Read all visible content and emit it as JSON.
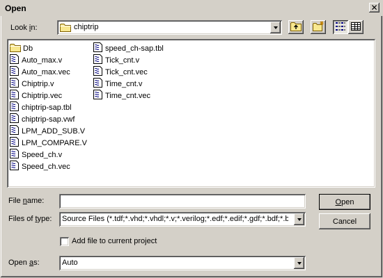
{
  "window": {
    "title": "Open"
  },
  "look_in": {
    "label_pre": "Look ",
    "label_ul": "i",
    "label_post": "n:",
    "value": "chiptrip",
    "value_icon": "folder-icon"
  },
  "toolbar": {
    "up_folder_icon": "up-folder-icon",
    "new_folder_icon": "new-folder-icon",
    "list_view_icon": "list-view-icon",
    "details_view_icon": "details-view-icon"
  },
  "files": {
    "column1": [
      {
        "name": "Db",
        "icon": "folder-icon"
      },
      {
        "name": "Auto_max.v",
        "icon": "document-icon"
      },
      {
        "name": "Auto_max.vec",
        "icon": "document-icon"
      },
      {
        "name": "Chiptrip.v",
        "icon": "document-icon"
      },
      {
        "name": "Chiptrip.vec",
        "icon": "document-icon"
      },
      {
        "name": "chiptrip-sap.tbl",
        "icon": "document-icon"
      },
      {
        "name": "chiptrip-sap.vwf",
        "icon": "document-icon"
      },
      {
        "name": "LPM_ADD_SUB.V",
        "icon": "document-icon"
      },
      {
        "name": "LPM_COMPARE.V",
        "icon": "document-icon"
      },
      {
        "name": "Speed_ch.v",
        "icon": "document-icon"
      },
      {
        "name": "Speed_ch.vec",
        "icon": "document-icon"
      }
    ],
    "column2": [
      {
        "name": "speed_ch-sap.tbl",
        "icon": "document-icon"
      },
      {
        "name": "Tick_cnt.v",
        "icon": "document-icon"
      },
      {
        "name": "Tick_cnt.vec",
        "icon": "document-icon"
      },
      {
        "name": "Time_cnt.v",
        "icon": "document-icon"
      },
      {
        "name": "Time_cnt.vec",
        "icon": "document-icon"
      }
    ]
  },
  "file_name": {
    "label_pre": "File ",
    "label_ul": "n",
    "label_post": "ame:",
    "value": ""
  },
  "file_type": {
    "label_pre": "Files of ",
    "label_ul": "t",
    "label_post": "ype:",
    "value": "Source Files (*.tdf;*.vhd;*.vhdl;*.v;*.verilog;*.edf;*.edif;*.gdf;*.bdf;*.bsf;*"
  },
  "add_to_project": {
    "label": "Add file to current project",
    "checked": false
  },
  "open_as": {
    "label_pre": "Open ",
    "label_ul": "a",
    "label_post": "s:",
    "value": "Auto"
  },
  "buttons": {
    "open_ul": "O",
    "open_rest": "pen",
    "cancel": "Cancel"
  }
}
